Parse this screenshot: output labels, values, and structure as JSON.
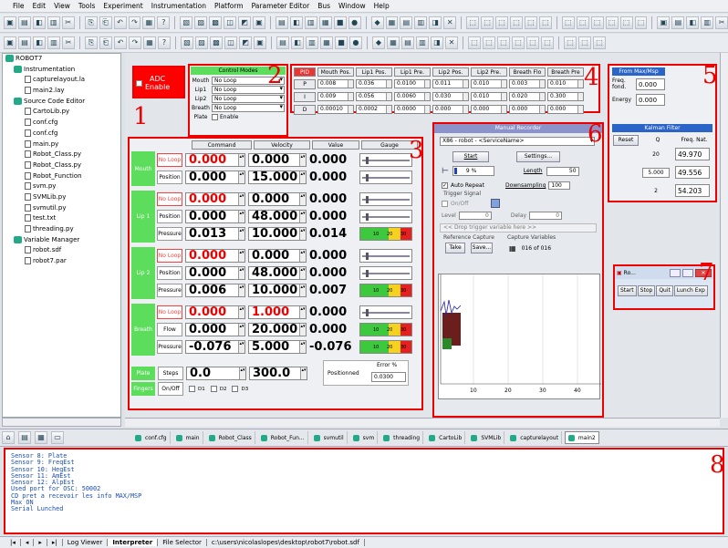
{
  "menu": [
    "File",
    "Edit",
    "View",
    "Tools",
    "Experiment",
    "Instrumentation",
    "Platform",
    "Parameter Editor",
    "Bus",
    "Window",
    "Help"
  ],
  "tree": {
    "root": "ROBOT7",
    "items": [
      {
        "label": "Instrumentation",
        "type": "folder",
        "indent": 1
      },
      {
        "label": "capturelayout.la",
        "type": "file",
        "indent": 2
      },
      {
        "label": "main2.lay",
        "type": "file",
        "indent": 2
      },
      {
        "label": "Source Code Editor",
        "type": "folder",
        "indent": 1
      },
      {
        "label": "CartoLib.py",
        "type": "file",
        "indent": 2
      },
      {
        "label": "conf.cfg",
        "type": "file",
        "indent": 2
      },
      {
        "label": "conf.cfg",
        "type": "file",
        "indent": 2
      },
      {
        "label": "main.py",
        "type": "file",
        "indent": 2
      },
      {
        "label": "Robot_Class.py",
        "type": "file",
        "indent": 2
      },
      {
        "label": "Robot_Class.py",
        "type": "file",
        "indent": 2
      },
      {
        "label": "Robot_Function",
        "type": "file",
        "indent": 2
      },
      {
        "label": "svm.py",
        "type": "file",
        "indent": 2
      },
      {
        "label": "SVMLib.py",
        "type": "file",
        "indent": 2
      },
      {
        "label": "svmutil.py",
        "type": "file",
        "indent": 2
      },
      {
        "label": "test.txt",
        "type": "file",
        "indent": 2
      },
      {
        "label": "threading.py",
        "type": "file",
        "indent": 2
      },
      {
        "label": "Variable Manager",
        "type": "folder",
        "indent": 1
      },
      {
        "label": "robot.sdf",
        "type": "file",
        "indent": 2
      },
      {
        "label": "robot7.par",
        "type": "file",
        "indent": 2
      }
    ]
  },
  "annotations": [
    "1",
    "2",
    "3",
    "4",
    "5",
    "6",
    "7",
    "8"
  ],
  "adc": {
    "label1": "ADC",
    "label2": "Enable"
  },
  "control_modes": {
    "title": "Control Modes",
    "rows": [
      {
        "label": "Mouth",
        "value": "No Loop"
      },
      {
        "label": "Lip1",
        "value": "No Loop"
      },
      {
        "label": "Lip2",
        "value": "No Loop"
      },
      {
        "label": "Breath",
        "value": "No Loop"
      }
    ],
    "plate_label": "Plate",
    "enable_label": "Enable"
  },
  "pid": {
    "pid_label": "PID",
    "headers": [
      "Mouth Pos.",
      "Lip1 Pos.",
      "Lip1 Pre.",
      "Lip2 Pos.",
      "Lip2 Pre.",
      "Breath Flo",
      "Breath Pre"
    ],
    "rows": [
      {
        "label": "P",
        "values": [
          "0.008",
          "0.036",
          "0.0100",
          "0.011",
          "0.010",
          "0.003",
          "0.010"
        ]
      },
      {
        "label": "I",
        "values": [
          "0.009",
          "0.056",
          "0.0060",
          "0.030",
          "0.010",
          "0.020",
          "0.300"
        ]
      },
      {
        "label": "D",
        "values": [
          "0.00010",
          "0.0002",
          "0.0000",
          "0.000",
          "0.000",
          "0.000",
          "0.000"
        ]
      }
    ]
  },
  "maxmsp": {
    "title": "From Max/Msp",
    "rows": [
      {
        "label": "Freq. fond.",
        "value": "0.000"
      },
      {
        "label": "Energy",
        "value": "0.000"
      }
    ]
  },
  "kalman": {
    "title": "Kalman Filter",
    "reset": "Reset",
    "q_label": "Q",
    "fn_label": "Freq. Nat.",
    "rows": [
      {
        "q": "20",
        "fn": "49.970"
      },
      {
        "q": "5.000",
        "fn": "49.556"
      },
      {
        "q": "2",
        "fn": "54.203"
      }
    ]
  },
  "control": {
    "headers": [
      "Command",
      "Velocity",
      "Value",
      "Gauge"
    ],
    "groups": [
      {
        "name": "Mouth",
        "rows": [
          {
            "sub": "No Loop",
            "cmd": "0.000",
            "vel": "0.000",
            "val": "0.000",
            "red": true,
            "gauge_fill": 0
          },
          {
            "sub": "Position",
            "cmd": "0.000",
            "vel": "15.000",
            "val": "0.000",
            "red": false,
            "gauge_fill": 0
          }
        ]
      },
      {
        "name": "Lip 1",
        "rows": [
          {
            "sub": "No Loop",
            "cmd": "0.000",
            "vel": "0.000",
            "val": "0.000",
            "red": true,
            "gauge_fill": 0
          },
          {
            "sub": "Position",
            "cmd": "0.000",
            "vel": "48.000",
            "val": "0.000",
            "red": false,
            "gauge_fill": 0
          },
          {
            "sub": "Pressure",
            "cmd": "0.013",
            "vel": "10.000",
            "val": "0.014",
            "red": false,
            "gauge_fill": 0.6
          }
        ]
      },
      {
        "name": "Lip 2",
        "rows": [
          {
            "sub": "No Loop",
            "cmd": "0.000",
            "vel": "0.000",
            "val": "0.000",
            "red": true,
            "gauge_fill": 0
          },
          {
            "sub": "Position",
            "cmd": "0.000",
            "vel": "48.000",
            "val": "0.000",
            "red": false,
            "gauge_fill": 0
          },
          {
            "sub": "Pressure",
            "cmd": "0.006",
            "vel": "10.000",
            "val": "0.007",
            "red": false,
            "gauge_fill": 0.6
          }
        ]
      },
      {
        "name": "Breath",
        "rows": [
          {
            "sub": "No Loop",
            "cmd": "0.000",
            "vel": "1.000",
            "val": "0.000",
            "red": true,
            "gauge_fill": 0
          },
          {
            "sub": "Flow",
            "cmd": "0.000",
            "vel": "20.000",
            "val": "0.000",
            "red": false,
            "gauge_fill": 0.8
          },
          {
            "sub": "Pressure",
            "cmd": "-0.076",
            "vel": "5.000",
            "val": "-0.076",
            "red": false,
            "gauge_fill": 0.8
          }
        ]
      }
    ],
    "plate": {
      "name": "Plate",
      "sub": "Steps",
      "cmd": "0.0",
      "vel": "300.0"
    },
    "fingers": {
      "name": "Fingers",
      "sub": "On/Off",
      "d1": "D1",
      "d2": "D2",
      "d3": "D3"
    },
    "positioned": "Positionned",
    "error_label": "Error %",
    "error_value": "0.0300",
    "gauge_ticks": [
      "10",
      "20",
      "30"
    ]
  },
  "recorder": {
    "title": "Manual Recorder",
    "target": "X86 - robot - <ServiceName>",
    "start": "Start",
    "settings": "Settings...",
    "progress": "9 %",
    "length_label": "Length",
    "length": "50",
    "auto_repeat": "Auto Repeat",
    "downsampling": "Downsampling",
    "downsampling_value": "100",
    "trigger": "Trigger Signal",
    "onoff": "On/Off",
    "level_label": "Level",
    "level": "0",
    "delay_label": "Delay",
    "delay": "0",
    "drop": "<< Drop trigger variable here >>",
    "ref_capture": "Reference Capture",
    "take": "Take",
    "save": "Save...",
    "capture_vars": "Capture Variables",
    "capture_count": "016 of 016",
    "axis": [
      "10",
      "20",
      "30",
      "40"
    ]
  },
  "mini": {
    "title": "Ro...",
    "buttons": [
      "Start",
      "Stop",
      "Quit",
      "Lunch Exp"
    ]
  },
  "tabs": [
    "conf.cfg",
    "main",
    "Robot_Class",
    "Robot_Fun...",
    "svmutil",
    "svm",
    "threading",
    "CartoLib",
    "SVMLib",
    "capturelayout",
    "main2"
  ],
  "console": [
    "Sensor 8: Plate",
    "Sensor 9: FreqEst",
    "Sensor 10: HegEst",
    "Sensor 11: AmEst",
    "Sensor 12: AlpEst",
    "Used port for OSC: 50002",
    "CD pret a recevoir les info MAX/MSP",
    "Max ON",
    "Serial Lunched"
  ],
  "bottom_tabs": [
    "Log Viewer",
    "Interpreter",
    "File Selector",
    "c:\\users\\nicolaslopes\\desktop\\robot7\\robot.sdf"
  ]
}
